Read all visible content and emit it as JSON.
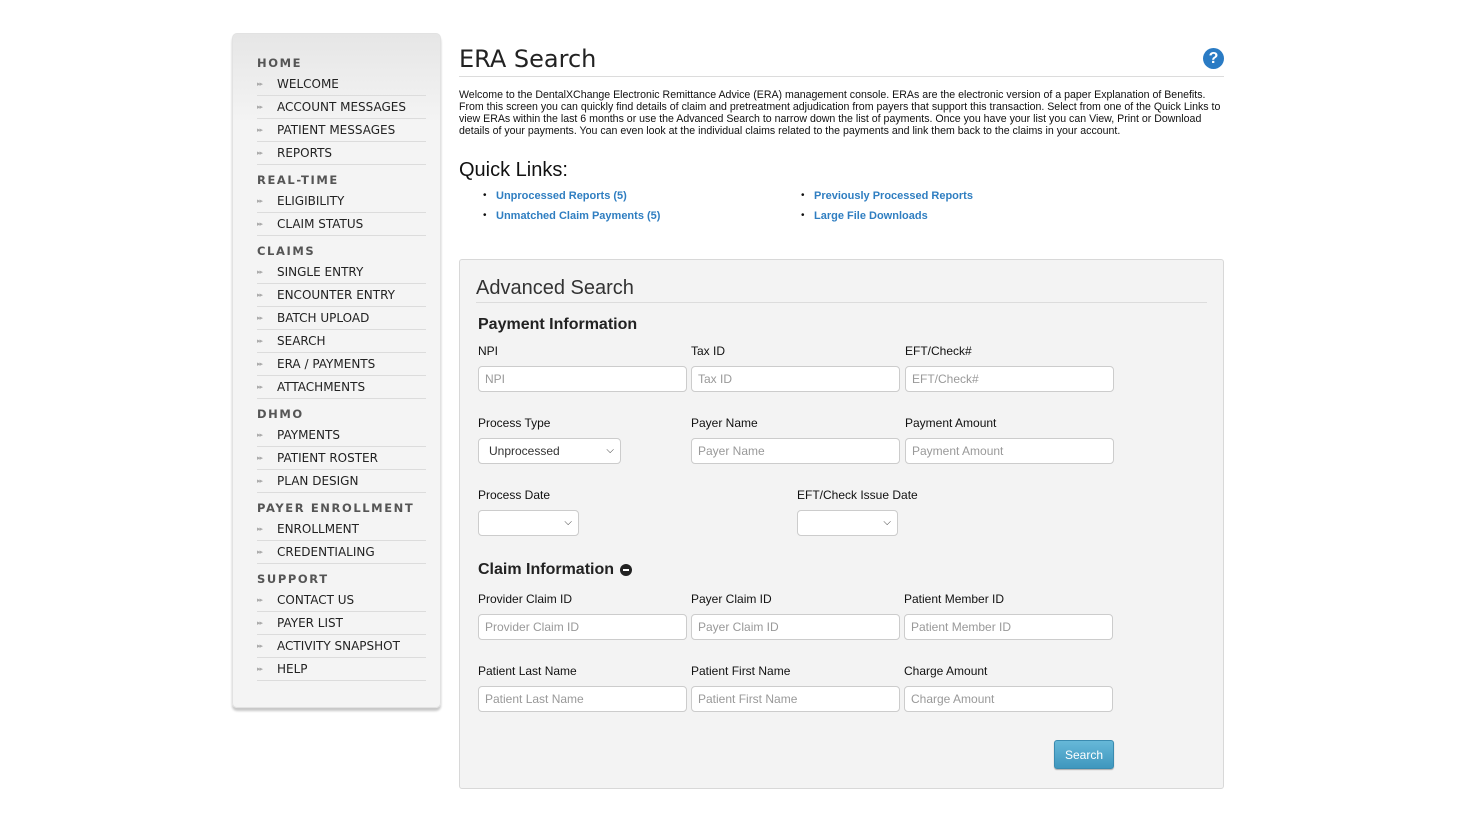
{
  "sidebar": {
    "sections": [
      {
        "heading": "HOME",
        "items": [
          "WELCOME",
          "ACCOUNT MESSAGES",
          "PATIENT MESSAGES",
          "REPORTS"
        ]
      },
      {
        "heading": "REAL-TIME",
        "items": [
          "ELIGIBILITY",
          "CLAIM STATUS"
        ]
      },
      {
        "heading": "CLAIMS",
        "items": [
          "SINGLE ENTRY",
          "ENCOUNTER ENTRY",
          "BATCH UPLOAD",
          "SEARCH",
          "ERA / PAYMENTS",
          "ATTACHMENTS"
        ]
      },
      {
        "heading": "DHMO",
        "items": [
          "PAYMENTS",
          "PATIENT ROSTER",
          "PLAN DESIGN"
        ]
      },
      {
        "heading": "PAYER ENROLLMENT",
        "items": [
          "ENROLLMENT",
          "CREDENTIALING"
        ]
      },
      {
        "heading": "SUPPORT",
        "items": [
          "CONTACT US",
          "PAYER LIST",
          "ACTIVITY SNAPSHOT",
          "HELP"
        ]
      }
    ],
    "item_icon": "double-chevron-right-icon"
  },
  "header": {
    "title": "ERA Search",
    "help_icon": "?"
  },
  "intro": "Welcome to the DentalXChange Electronic Remittance Advice (ERA) management console. ERAs are the electronic version of a paper Explanation of Benefits. From this screen you can quickly find details of claim and pretreatment adjudication from payers that support this transaction. Select from one of the Quick Links to view ERAs within the last 6 months or use the Advanced Search to narrow down the list of payments. Once you have your list you can View, Print or Download details of your payments. You can even look at the individual claims related to the payments and link them back to the claims in your account.",
  "quick_links": {
    "title": "Quick Links:",
    "links": [
      "Unprocessed Reports (5)",
      "Previously Processed Reports",
      "Unmatched Claim Payments (5)",
      "Large File Downloads"
    ]
  },
  "advanced_search": {
    "title": "Advanced Search",
    "payment_info": {
      "title": "Payment Information",
      "npi": {
        "label": "NPI",
        "placeholder": "NPI",
        "value": ""
      },
      "tax_id": {
        "label": "Tax ID",
        "placeholder": "Tax ID",
        "value": ""
      },
      "eft_check": {
        "label": "EFT/Check#",
        "placeholder": "EFT/Check#",
        "value": ""
      },
      "process_type": {
        "label": "Process Type",
        "selected": "Unprocessed"
      },
      "payer_name": {
        "label": "Payer Name",
        "placeholder": "Payer Name",
        "value": ""
      },
      "payment_amount": {
        "label": "Payment Amount",
        "placeholder": "Payment Amount",
        "value": ""
      },
      "process_date": {
        "label": "Process Date",
        "selected": ""
      },
      "eft_issue_date": {
        "label": "EFT/Check Issue Date",
        "selected": ""
      }
    },
    "claim_info": {
      "title": "Claim Information",
      "provider_claim_id": {
        "label": "Provider Claim ID",
        "placeholder": "Provider Claim ID",
        "value": ""
      },
      "payer_claim_id": {
        "label": "Payer Claim ID",
        "placeholder": "Payer Claim ID",
        "value": ""
      },
      "patient_member_id": {
        "label": "Patient Member ID",
        "placeholder": "Patient Member ID",
        "value": ""
      },
      "patient_last_name": {
        "label": "Patient Last Name",
        "placeholder": "Patient Last Name",
        "value": ""
      },
      "patient_first_name": {
        "label": "Patient First Name",
        "placeholder": "Patient First Name",
        "value": ""
      },
      "charge_amount": {
        "label": "Charge Amount",
        "placeholder": "Charge Amount",
        "value": ""
      }
    },
    "search_label": "Search"
  },
  "colors": {
    "link": "#2f7ec1",
    "help_icon": "#2a7bc4",
    "search_button": "#4aa3c9",
    "panel_bg": "#f3f3f3"
  }
}
